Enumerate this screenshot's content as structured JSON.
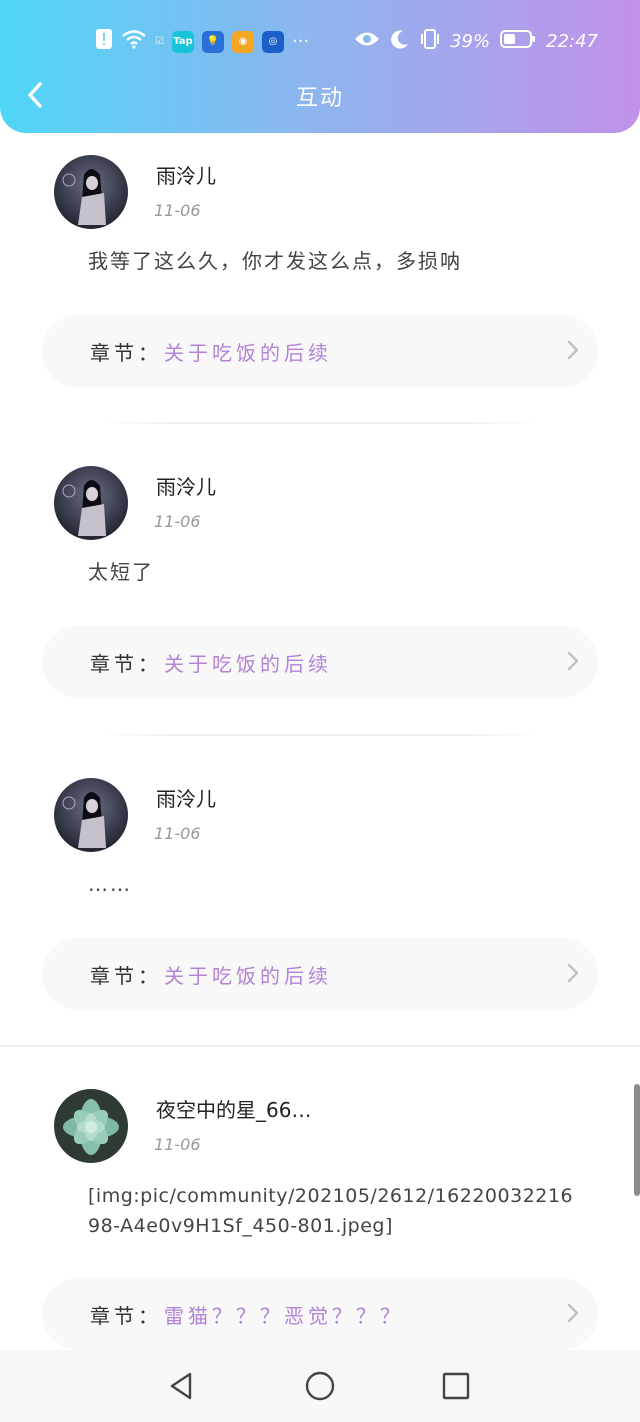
{
  "status_bar": {
    "battery_percent": "39%",
    "time": "22:47",
    "more": "···"
  },
  "nav": {
    "title": "互动"
  },
  "comments": [
    {
      "username": "雨泠儿",
      "date": "11-06",
      "text": "我等了这么久，你才发这么点，多损呐",
      "chapter_label": "章节：",
      "chapter_name": "关于吃饭的后续"
    },
    {
      "username": "雨泠儿",
      "date": "11-06",
      "text": "太短了",
      "chapter_label": "章节：",
      "chapter_name": "关于吃饭的后续"
    },
    {
      "username": "雨泠儿",
      "date": "11-06",
      "text": "……",
      "chapter_label": "章节：",
      "chapter_name": "关于吃饭的后续"
    },
    {
      "username": "夜空中的星_66…",
      "date": "11-06",
      "text": "[img:pic/community/202105/2612/1622003221698-A4e0v9H1Sf_450-801.jpeg]",
      "chapter_label": "章节：",
      "chapter_name": "雷猫？？？恶觉？？？"
    }
  ],
  "colors": {
    "gradient_start": "#4fd6f7",
    "gradient_end": "#c191ea",
    "chapter_accent": "#b383d6"
  }
}
